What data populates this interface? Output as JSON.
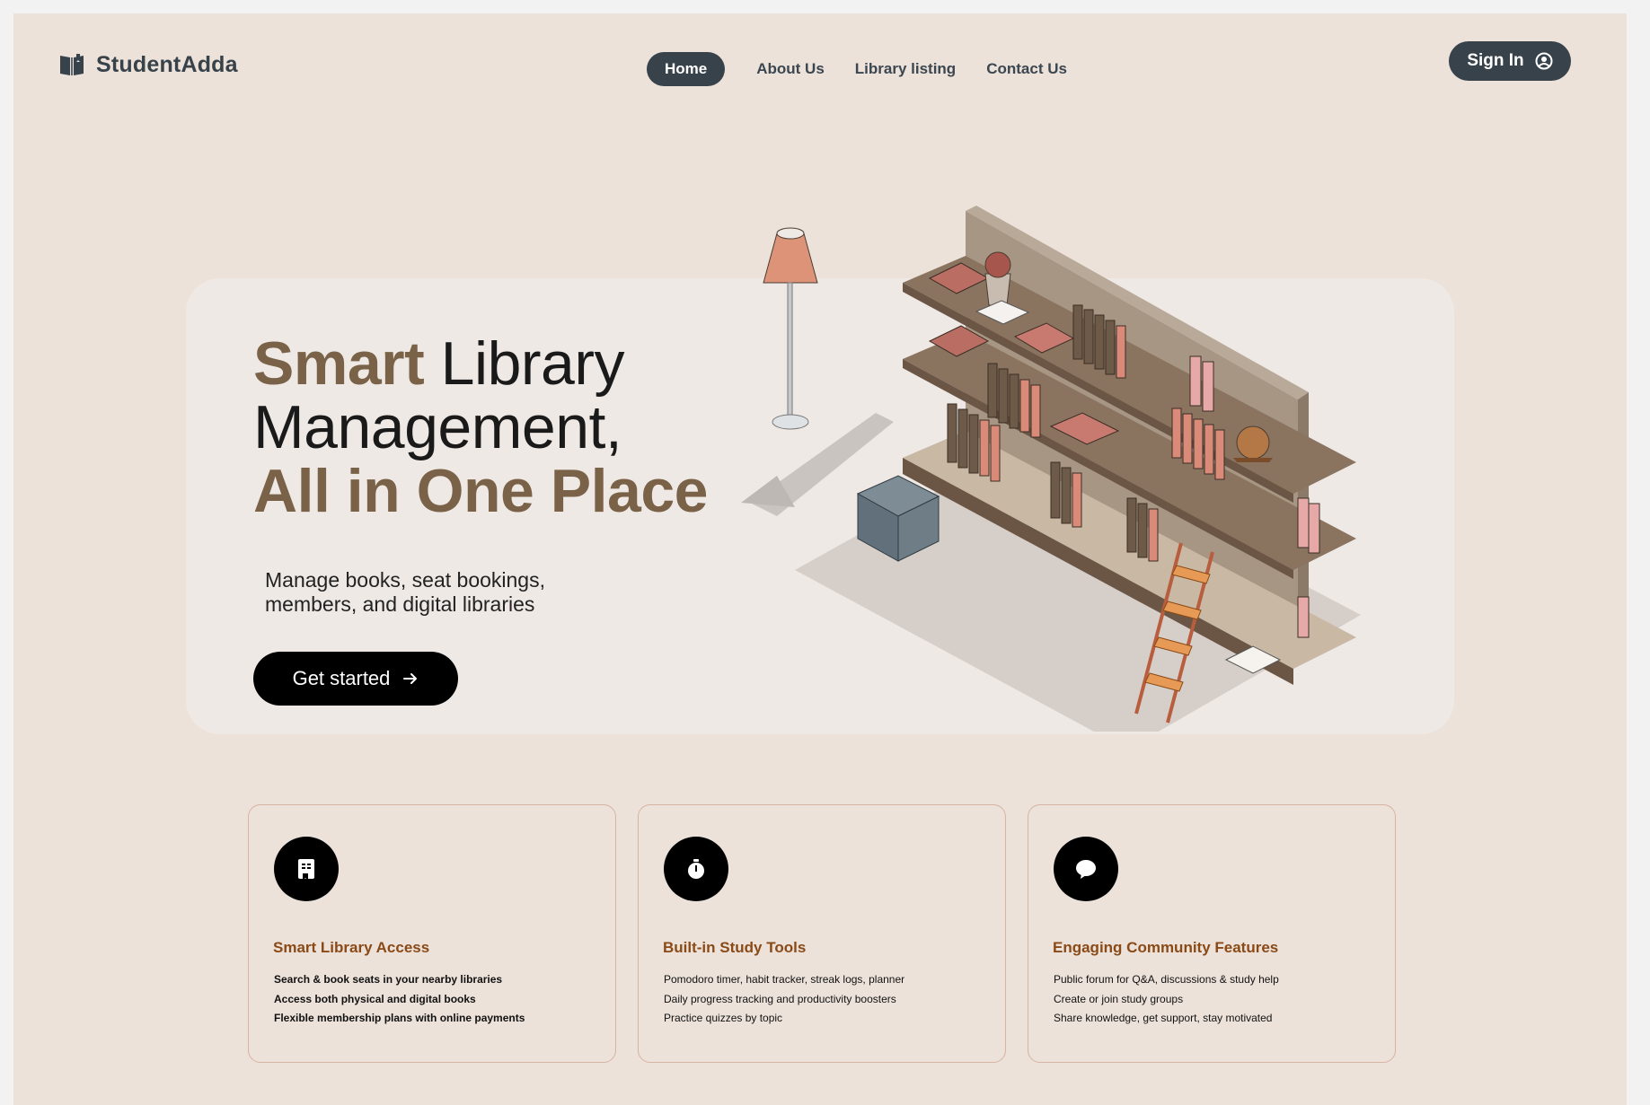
{
  "header": {
    "brand": "StudentAdda",
    "logo_icon": "open-book-icon",
    "nav": [
      {
        "label": "Home",
        "active": true
      },
      {
        "label": "About Us",
        "active": false
      },
      {
        "label": "Library listing",
        "active": false
      },
      {
        "label": "Contact Us",
        "active": false
      }
    ],
    "signin_label": "Sign In",
    "signin_icon": "user-circle-icon"
  },
  "hero": {
    "title_line1_accent": "Smart",
    "title_line1_rest": " Library",
    "title_line2": "Management,",
    "title_line3": "All in One Place",
    "subtitle_line1": "Manage books, seat bookings,",
    "subtitle_line2": "members, and digital libraries",
    "cta_label": "Get started",
    "cta_icon": "arrow-right-icon",
    "illustration": "isometric-bookshelf-illustration"
  },
  "features": [
    {
      "icon": "book-bookmark-icon",
      "title": "Smart Library Access",
      "items": [
        "Search & book seats in your nearby libraries",
        "Access both physical and digital books",
        "Flexible membership plans with online payments"
      ]
    },
    {
      "icon": "stopwatch-icon",
      "title": "Built-in Study Tools",
      "items": [
        "Pomodoro timer, habit tracker, streak logs, planner",
        "Daily progress tracking and productivity boosters",
        "Practice quizzes by topic"
      ]
    },
    {
      "icon": "chat-bubble-icon",
      "title": "Engaging Community Features",
      "items": [
        "Public forum for Q&A, discussions & study help",
        "Create or join study groups",
        "Share knowledge, get support, stay motivated"
      ]
    }
  ],
  "colors": {
    "page_bg": "#ece2da",
    "hero_bg": "#efe9e5",
    "nav_dark": "#38424a",
    "accent_brown": "#7a6248",
    "card_title": "#8a4a17",
    "card_border": "#d8b2a2"
  }
}
